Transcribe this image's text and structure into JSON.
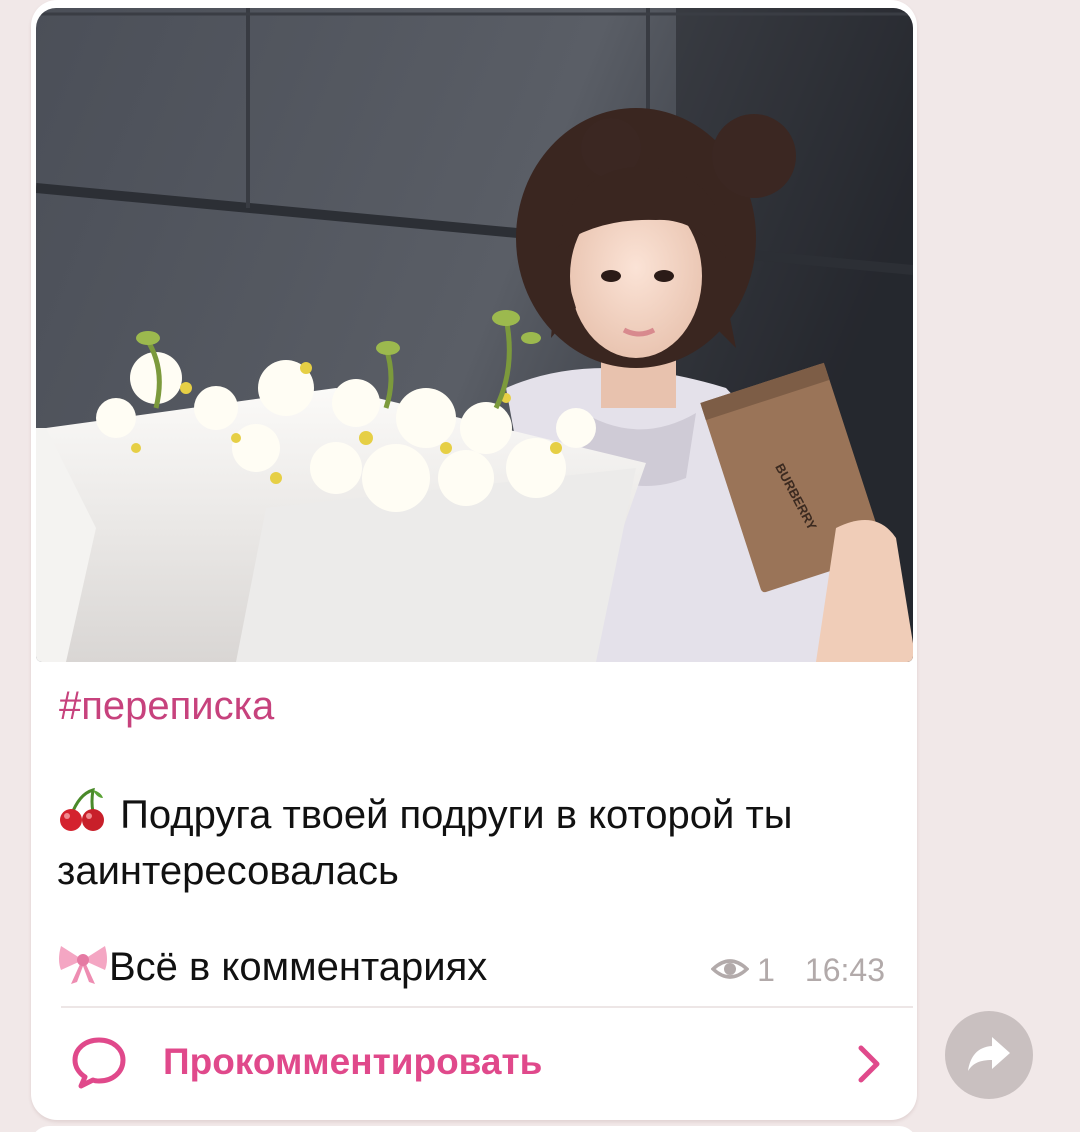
{
  "post": {
    "photo": {
      "box_brand": "BURBERRY"
    },
    "hashtag": "#переписка",
    "body_emoji": "cherries",
    "body_text": "Подруга твоей подруги в которой ты заинтересовалась",
    "footer_emoji": "ribbon",
    "footer_text": "Всё в комментариях",
    "views": "1",
    "time": "16:43",
    "comment_label": "Прокомментировать"
  },
  "icons": {
    "views": "eye-icon",
    "comment": "speech-bubble-icon",
    "chevron": "chevron-right-icon",
    "share": "share-arrow-icon"
  },
  "colors": {
    "accent": "#e0498b",
    "hashtag": "#c7427d",
    "background": "#f1e8e8",
    "meta": "#b2aaaa",
    "share_button": "#c9c0c0"
  }
}
